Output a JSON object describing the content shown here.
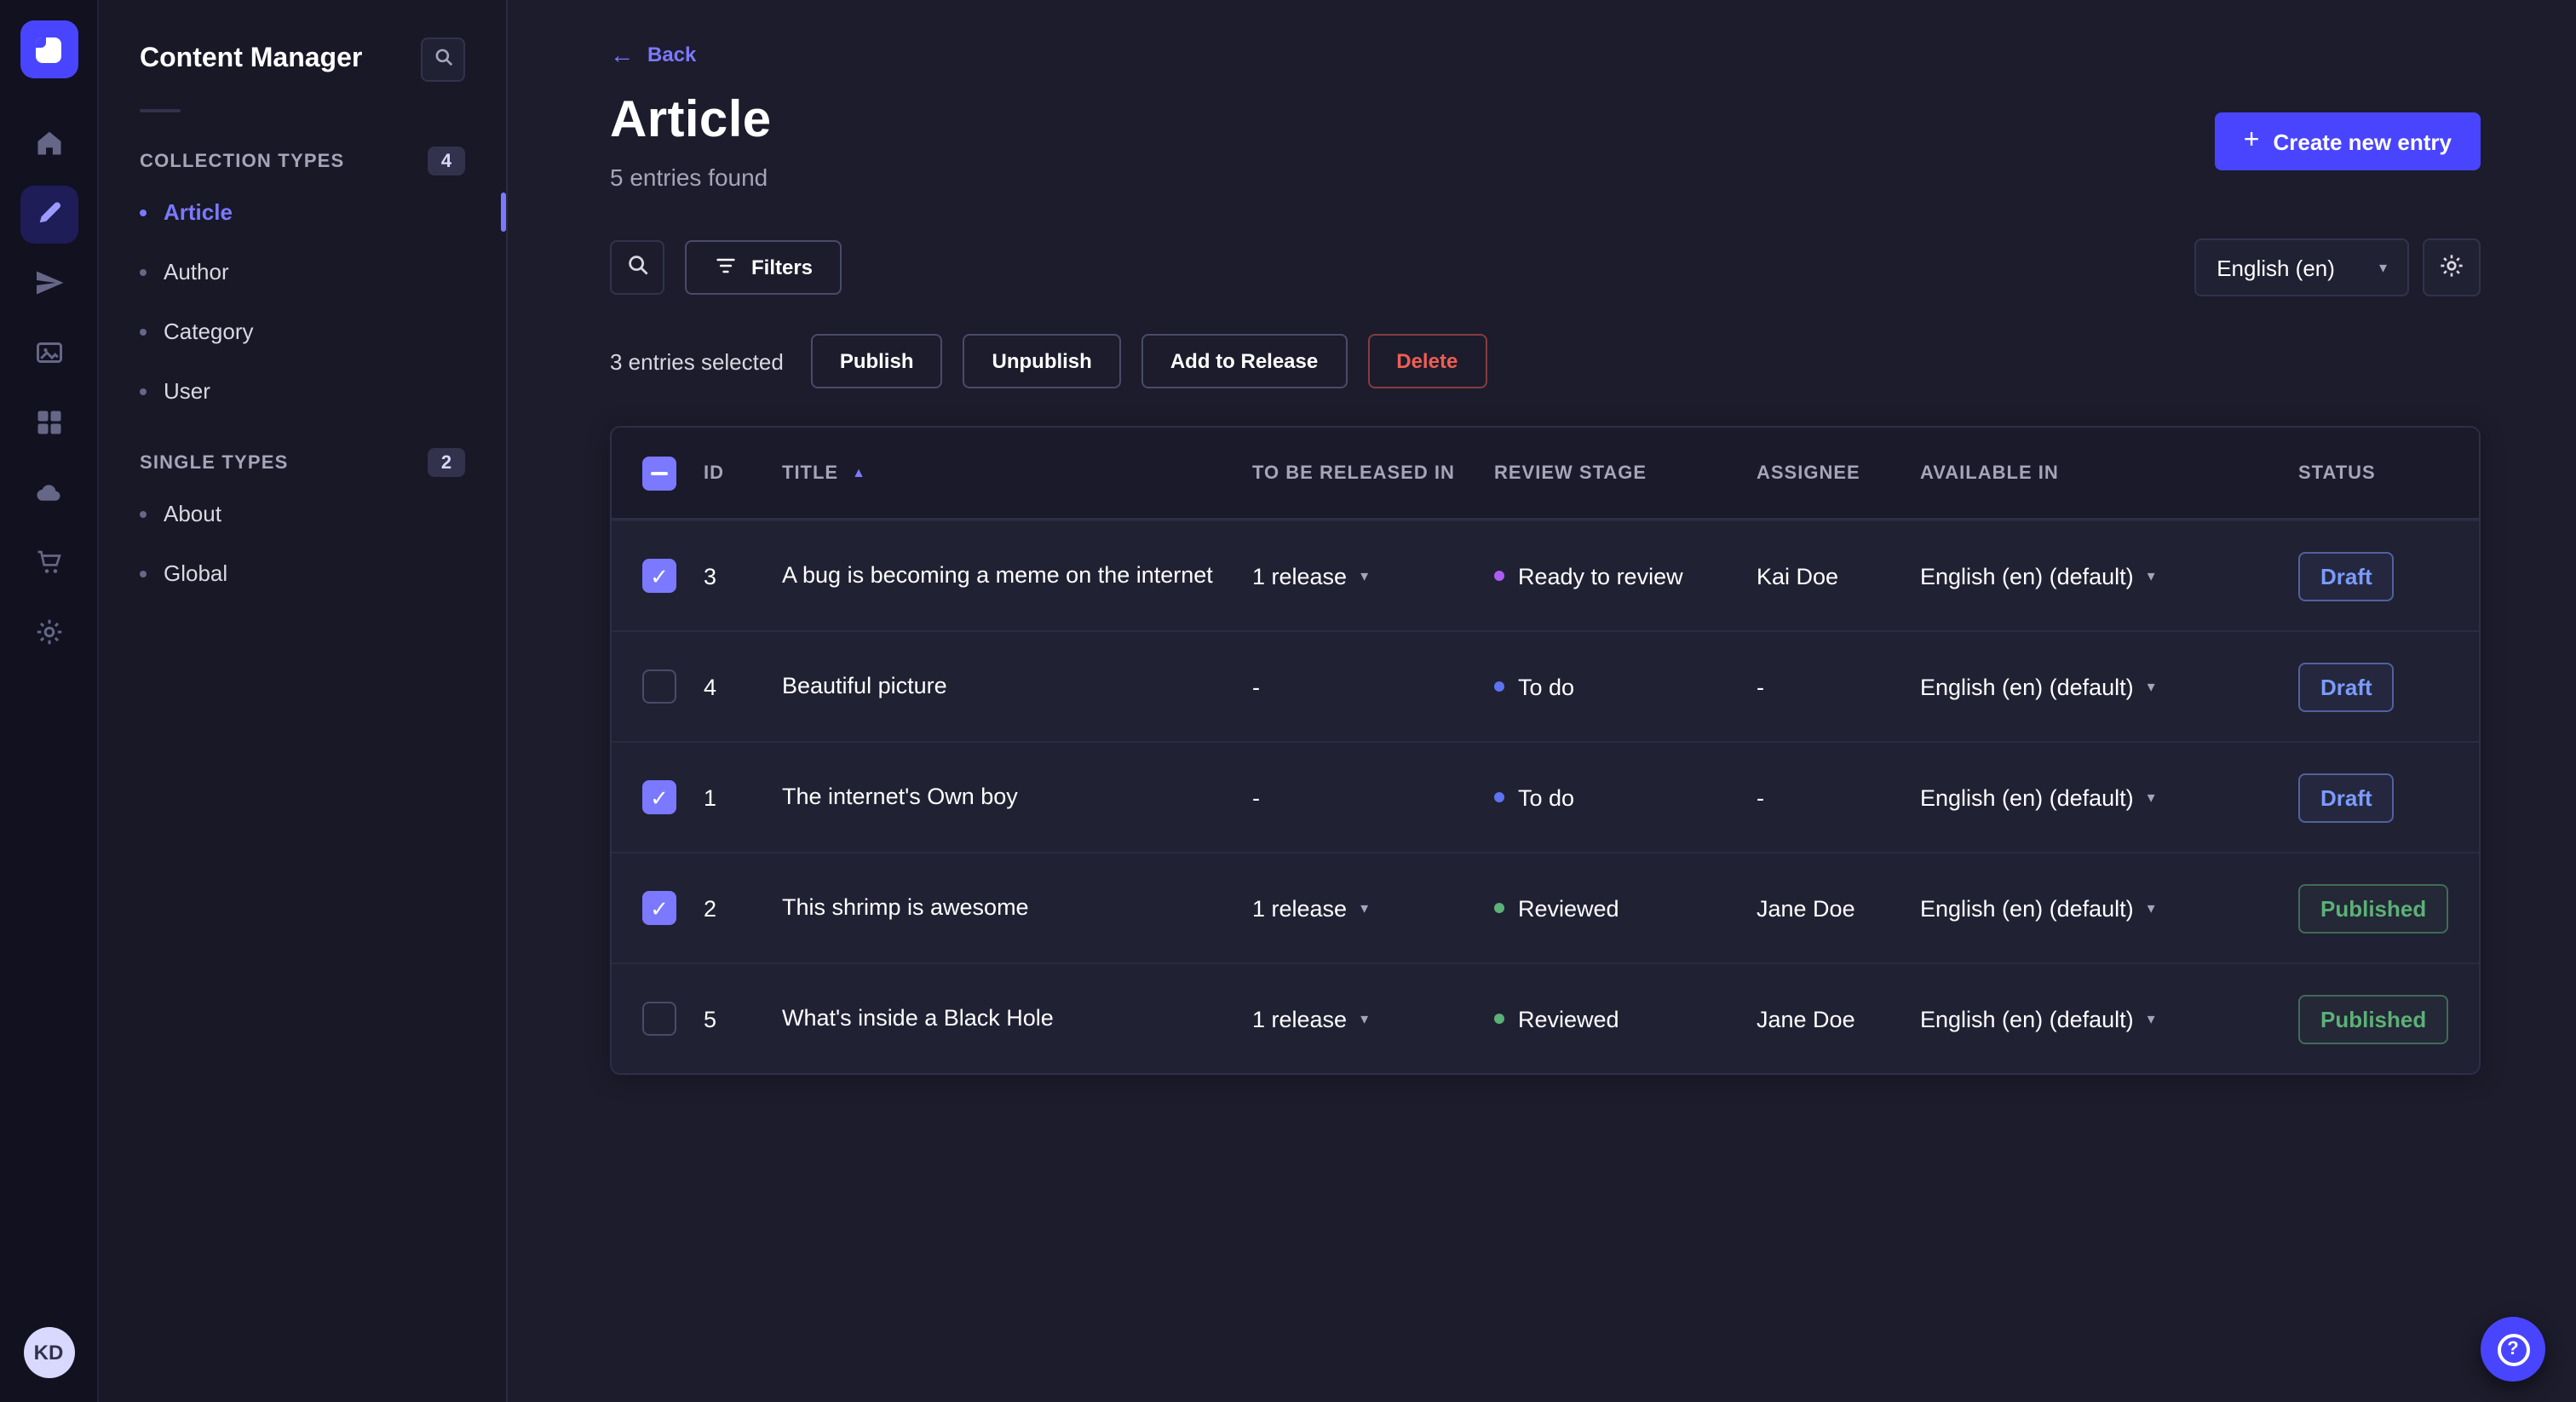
{
  "colors": {
    "primary": "#4945ff",
    "primary_light": "#7b79ff",
    "draft_status": "#7b9cfd",
    "published_status": "#5cb176",
    "danger": "#ee5e52",
    "stage_todo": "#5c73f2",
    "stage_ready_to_review": "#ad5cf2",
    "stage_reviewed": "#5cb176"
  },
  "nav_rail": {
    "items": [
      {
        "icon": "home-icon",
        "active": false
      },
      {
        "icon": "pen-icon",
        "active": true
      },
      {
        "icon": "paper-plane-icon",
        "active": false
      },
      {
        "icon": "images-icon",
        "active": false
      },
      {
        "icon": "layout-icon",
        "active": false
      },
      {
        "icon": "cloud-icon",
        "active": false
      },
      {
        "icon": "cart-icon",
        "active": false
      },
      {
        "icon": "gear-icon",
        "active": false
      }
    ],
    "avatar_initials": "KD"
  },
  "sidebar": {
    "title": "Content Manager",
    "sections": [
      {
        "label": "COLLECTION TYPES",
        "badge": "4",
        "items": [
          {
            "label": "Article",
            "active": true
          },
          {
            "label": "Author",
            "active": false
          },
          {
            "label": "Category",
            "active": false
          },
          {
            "label": "User",
            "active": false
          }
        ]
      },
      {
        "label": "SINGLE TYPES",
        "badge": "2",
        "items": [
          {
            "label": "About",
            "active": false
          },
          {
            "label": "Global",
            "active": false
          }
        ]
      }
    ]
  },
  "header": {
    "back_label": "Back",
    "title": "Article",
    "subtitle": "5 entries found",
    "create_button": "Create new entry"
  },
  "toolbar": {
    "filters_label": "Filters",
    "locale_select": "English (en)"
  },
  "selection_bar": {
    "selected_text": "3 entries selected",
    "actions": [
      "Publish",
      "Unpublish",
      "Add to Release",
      "Delete"
    ]
  },
  "table": {
    "sort_column": "TITLE",
    "sort_direction": "asc",
    "columns": [
      "ID",
      "TITLE",
      "TO BE RELEASED IN",
      "REVIEW STAGE",
      "ASSIGNEE",
      "AVAILABLE IN",
      "STATUS"
    ],
    "rows": [
      {
        "checked": true,
        "id": "3",
        "title": "A bug is becoming a meme on the internet",
        "release": "1 release",
        "release_menu": true,
        "review_stage": "Ready to review",
        "review_variant": "purple",
        "assignee": "Kai Doe",
        "available_in": "English (en) (default)",
        "status": "Draft",
        "status_variant": "draft"
      },
      {
        "checked": false,
        "id": "4",
        "title": "Beautiful picture",
        "release": "-",
        "release_menu": false,
        "review_stage": "To do",
        "review_variant": "blue",
        "assignee": "-",
        "available_in": "English (en) (default)",
        "status": "Draft",
        "status_variant": "draft"
      },
      {
        "checked": true,
        "id": "1",
        "title": "The internet's Own boy",
        "release": "-",
        "release_menu": false,
        "review_stage": "To do",
        "review_variant": "blue",
        "assignee": "-",
        "available_in": "English (en) (default)",
        "status": "Draft",
        "status_variant": "draft"
      },
      {
        "checked": true,
        "id": "2",
        "title": "This shrimp is awesome",
        "release": "1 release",
        "release_menu": true,
        "review_stage": "Reviewed",
        "review_variant": "green",
        "assignee": "Jane Doe",
        "available_in": "English (en) (default)",
        "status": "Published",
        "status_variant": "published"
      },
      {
        "checked": false,
        "id": "5",
        "title": "What's inside a Black Hole",
        "release": "1 release",
        "release_menu": true,
        "review_stage": "Reviewed",
        "review_variant": "green",
        "assignee": "Jane Doe",
        "available_in": "English (en) (default)",
        "status": "Published",
        "status_variant": "published"
      }
    ]
  },
  "help": {
    "question_mark": "?"
  }
}
